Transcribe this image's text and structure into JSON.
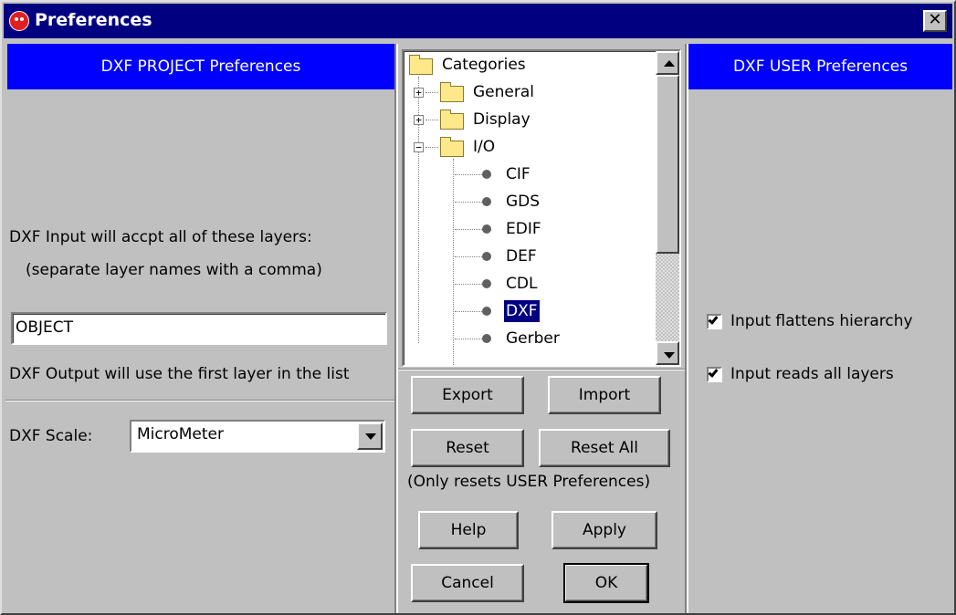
{
  "window": {
    "title": "Preferences",
    "close_label": "✕"
  },
  "project_panel": {
    "header": "DXF PROJECT Preferences",
    "input_label": "DXF Input will accpt all of these layers:",
    "input_hint": "(separate layer names with a comma)",
    "layers_value": "OBJECT",
    "output_note": "DXF Output will use the first layer in the list",
    "scale_label": "DXF Scale:",
    "scale_value": "MicroMeter"
  },
  "tree": {
    "root": "Categories",
    "groups": [
      {
        "label": "General",
        "expanded": false,
        "expander": "+"
      },
      {
        "label": "Display",
        "expanded": false,
        "expander": "+"
      },
      {
        "label": "I/O",
        "expanded": true,
        "expander": "−"
      }
    ],
    "io_items": [
      "CIF",
      "GDS",
      "EDIF",
      "DEF",
      "CDL",
      "DXF",
      "Gerber"
    ],
    "selected": "DXF"
  },
  "buttons": {
    "export": "Export",
    "import": "Import",
    "reset": "Reset",
    "reset_all": "Reset All",
    "reset_note": "(Only resets USER Preferences)",
    "help": "Help",
    "apply": "Apply",
    "cancel": "Cancel",
    "ok": "OK"
  },
  "user_panel": {
    "header": "DXF USER Preferences",
    "options": [
      {
        "label": "Input flattens hierarchy",
        "checked": true
      },
      {
        "label": "Input reads all layers",
        "checked": true
      }
    ]
  },
  "colors": {
    "title_bar": "#000080",
    "panel_header": "#0000ff",
    "selection": "#000080",
    "window_bg": "#c0c0c0"
  }
}
